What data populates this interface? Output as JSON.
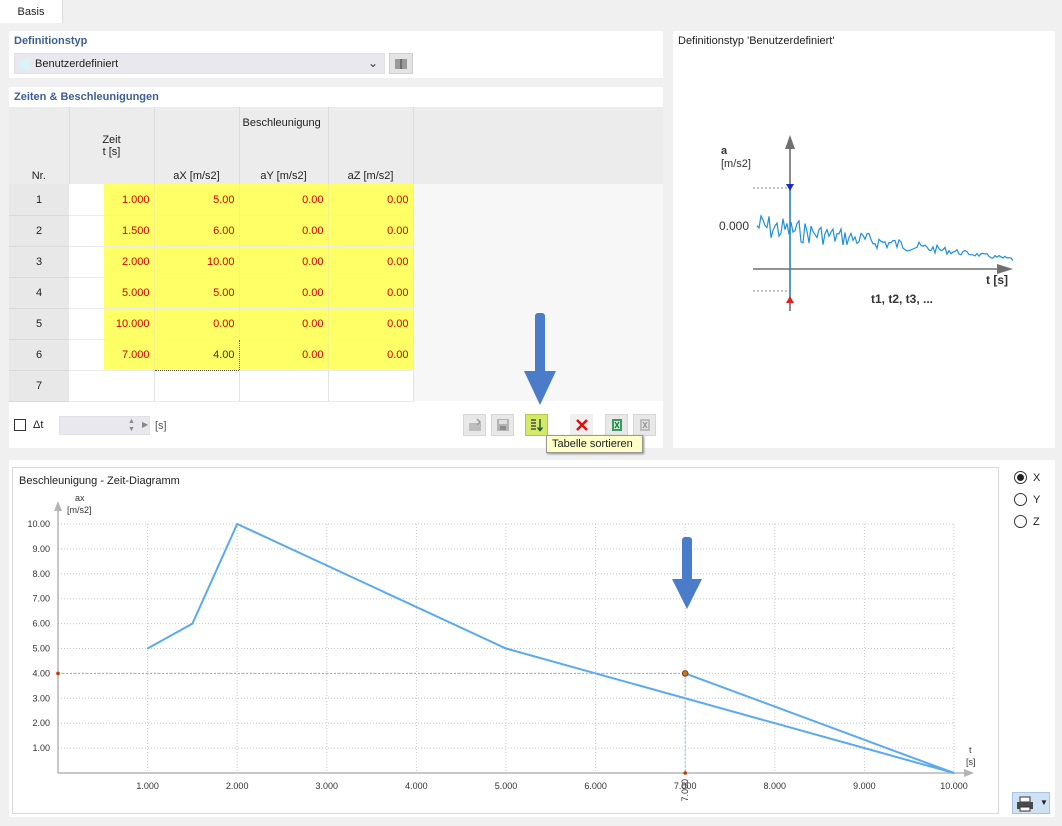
{
  "tabs": [
    {
      "label": "Basis"
    }
  ],
  "definition": {
    "section_title": "Definitionstyp",
    "selected": "Benutzerdefiniert"
  },
  "table": {
    "section_title": "Zeiten & Beschleunigungen",
    "header": {
      "nr": "Nr.",
      "zeit": "Zeit",
      "zeit_unit": "t [s]",
      "group": "Beschleunigung",
      "ax_unit": "aX [m/s2]",
      "ay_unit": "aY [m/s2]",
      "az_unit": "aZ [m/s2]"
    },
    "rows": [
      {
        "nr": "1",
        "t": "1.000",
        "ax": "5.00",
        "ay": "0.00",
        "az": "0.00"
      },
      {
        "nr": "2",
        "t": "1.500",
        "ax": "6.00",
        "ay": "0.00",
        "az": "0.00"
      },
      {
        "nr": "3",
        "t": "2.000",
        "ax": "10.00",
        "ay": "0.00",
        "az": "0.00"
      },
      {
        "nr": "4",
        "t": "5.000",
        "ax": "5.00",
        "ay": "0.00",
        "az": "0.00"
      },
      {
        "nr": "5",
        "t": "10.000",
        "ax": "0.00",
        "ay": "0.00",
        "az": "0.00"
      },
      {
        "nr": "6",
        "t": "7.000",
        "ax": "4.00",
        "ay": "0.00",
        "az": "0.00"
      },
      {
        "nr": "7",
        "t": "",
        "ax": "",
        "ay": "",
        "az": ""
      }
    ]
  },
  "toolbar": {
    "delta_label": "Δt",
    "unit": "[s]",
    "tooltip": "Tabelle sortieren",
    "icons": [
      "import-icon",
      "save-icon",
      "sort-table-icon",
      "delete-icon",
      "export-excel-icon",
      "import-excel-icon"
    ]
  },
  "preview": {
    "title": "Definitionstyp 'Benutzerdefiniert'",
    "y_label": "a",
    "y_unit": "[m/s2]",
    "zero": "0.000",
    "x_label": "t [s]",
    "times": "t1, t2, t3, ..."
  },
  "diagram": {
    "title": "Beschleunigung - Zeit-Diagramm",
    "y_label": "ax",
    "y_unit": "[m/s2]",
    "x_label": "t",
    "x_unit": "[s]",
    "marker_label": "7.000"
  },
  "direction": {
    "options": [
      {
        "label": "X",
        "selected": true
      },
      {
        "label": "Y",
        "selected": false
      },
      {
        "label": "Z",
        "selected": false
      }
    ]
  },
  "colors": {
    "accent": "#3f5e94",
    "line": "#5aaaf0",
    "highlight": "#ffff66",
    "arrow": "#4a7cc9"
  },
  "chart_data": {
    "type": "line",
    "title": "Beschleunigung - Zeit-Diagramm",
    "xlabel": "t [s]",
    "ylabel": "ax [m/s2]",
    "x": [
      1.0,
      1.5,
      2.0,
      5.0,
      10.0,
      7.0
    ],
    "values": [
      5.0,
      6.0,
      10.0,
      5.0,
      0.0,
      4.0
    ],
    "xlim": [
      0,
      10
    ],
    "ylim": [
      0,
      10
    ],
    "x_ticks": [
      "1.000",
      "2.000",
      "3.000",
      "4.000",
      "5.000",
      "6.000",
      "7.000",
      "8.000",
      "9.000",
      "10.000"
    ],
    "y_ticks": [
      "1.00",
      "2.00",
      "3.00",
      "4.00",
      "5.00",
      "6.00",
      "7.00",
      "8.00",
      "9.00",
      "10.00"
    ],
    "grid": true,
    "highlight_point": {
      "x": 7.0,
      "y": 4.0
    }
  }
}
